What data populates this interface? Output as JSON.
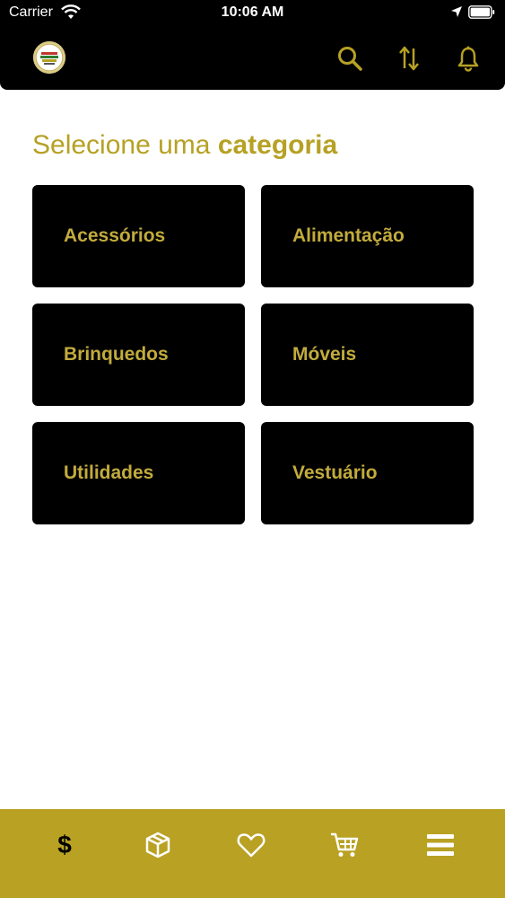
{
  "status_bar": {
    "carrier": "Carrier",
    "time": "10:06 AM"
  },
  "header": {
    "logo_icon": "store-logo",
    "actions": [
      {
        "icon": "search-icon"
      },
      {
        "icon": "sort-icon"
      },
      {
        "icon": "bell-icon"
      }
    ]
  },
  "main": {
    "title_prefix": "Selecione uma",
    "title_bold": "categoria",
    "categories": [
      {
        "label": "Acessórios"
      },
      {
        "label": "Alimentação"
      },
      {
        "label": "Brinquedos"
      },
      {
        "label": "Móveis"
      },
      {
        "label": "Utilidades"
      },
      {
        "label": "Vestuário"
      }
    ]
  },
  "bottom_nav": {
    "items": [
      {
        "icon": "dollar-icon",
        "glyph": "$"
      },
      {
        "icon": "package-icon"
      },
      {
        "icon": "heart-icon"
      },
      {
        "icon": "cart-icon"
      },
      {
        "icon": "menu-icon"
      }
    ]
  },
  "colors": {
    "accent": "#b6a124",
    "card_text": "#c2ab3c",
    "nav_bg": "#b9a123",
    "header_bg": "#000000"
  }
}
